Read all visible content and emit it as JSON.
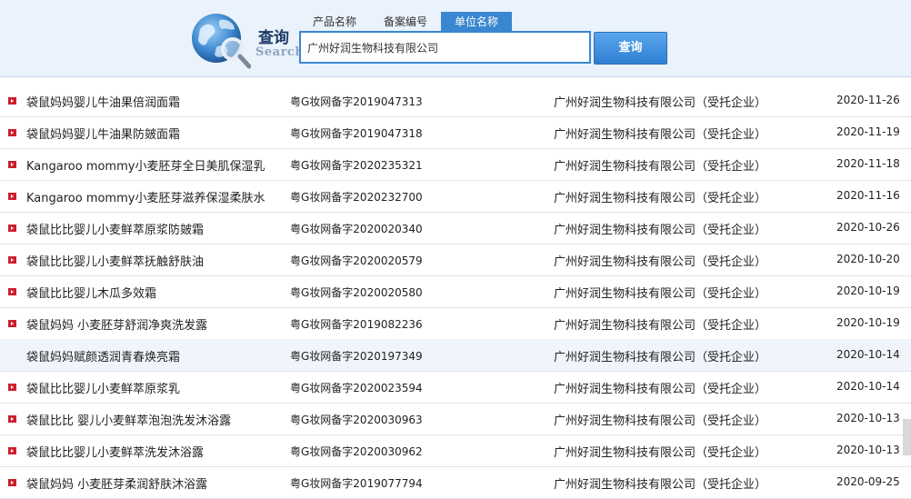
{
  "search": {
    "title": "查询",
    "subtitle": "Search",
    "tabs": [
      "产品名称",
      "备案编号",
      "单位名称"
    ],
    "active_tab": 2,
    "input_value": "广州好润生物科技有限公司",
    "button_label": "查询"
  },
  "colors": {
    "accent": "#3b86d0",
    "bullet": "#cc1f2d"
  },
  "rows": [
    {
      "name": "袋鼠妈妈婴儿牛油果倍润面霜",
      "code": "粤G妆网备字2019047313",
      "company": "广州好润生物科技有限公司（受托企业）",
      "date": "2020-11-26"
    },
    {
      "name": "袋鼠妈妈婴儿牛油果防皴面霜",
      "code": "粤G妆网备字2019047318",
      "company": "广州好润生物科技有限公司（受托企业）",
      "date": "2020-11-19"
    },
    {
      "name": "Kangaroo mommy小麦胚芽全日美肌保湿乳",
      "code": "粤G妆网备字2020235321",
      "company": "广州好润生物科技有限公司（受托企业）",
      "date": "2020-11-18"
    },
    {
      "name": "Kangaroo mommy小麦胚芽滋养保湿柔肤水",
      "code": "粤G妆网备字2020232700",
      "company": "广州好润生物科技有限公司（受托企业）",
      "date": "2020-11-16"
    },
    {
      "name": "袋鼠比比婴儿小麦鲜萃原浆防皴霜",
      "code": "粤G妆网备字2020020340",
      "company": "广州好润生物科技有限公司（受托企业）",
      "date": "2020-10-26"
    },
    {
      "name": "袋鼠比比婴儿小麦鲜萃抚触舒肤油",
      "code": "粤G妆网备字2020020579",
      "company": "广州好润生物科技有限公司（受托企业）",
      "date": "2020-10-20"
    },
    {
      "name": "袋鼠比比婴儿木瓜多效霜",
      "code": "粤G妆网备字2020020580",
      "company": "广州好润生物科技有限公司（受托企业）",
      "date": "2020-10-19"
    },
    {
      "name": "袋鼠妈妈 小麦胚芽舒润净爽洗发露",
      "code": "粤G妆网备字2019082236",
      "company": "广州好润生物科技有限公司（受托企业）",
      "date": "2020-10-19"
    },
    {
      "name": "袋鼠妈妈赋颜透润青春焕亮霜",
      "code": "粤G妆网备字2020197349",
      "company": "广州好润生物科技有限公司（受托企业）",
      "date": "2020-10-14"
    },
    {
      "name": "袋鼠比比婴儿小麦鲜萃原浆乳",
      "code": "粤G妆网备字2020023594",
      "company": "广州好润生物科技有限公司（受托企业）",
      "date": "2020-10-14"
    },
    {
      "name": "袋鼠比比 婴儿小麦鲜萃泡泡洗发沐浴露",
      "code": "粤G妆网备字2020030963",
      "company": "广州好润生物科技有限公司（受托企业）",
      "date": "2020-10-13"
    },
    {
      "name": "袋鼠比比婴儿小麦鲜萃洗发沐浴露",
      "code": "粤G妆网备字2020030962",
      "company": "广州好润生物科技有限公司（受托企业）",
      "date": "2020-10-13"
    },
    {
      "name": "袋鼠妈妈 小麦胚芽柔润舒肤沐浴露",
      "code": "粤G妆网备字2019077794",
      "company": "广州好润生物科技有限公司（受托企业）",
      "date": "2020-09-25"
    }
  ],
  "highlighted_row": 8
}
